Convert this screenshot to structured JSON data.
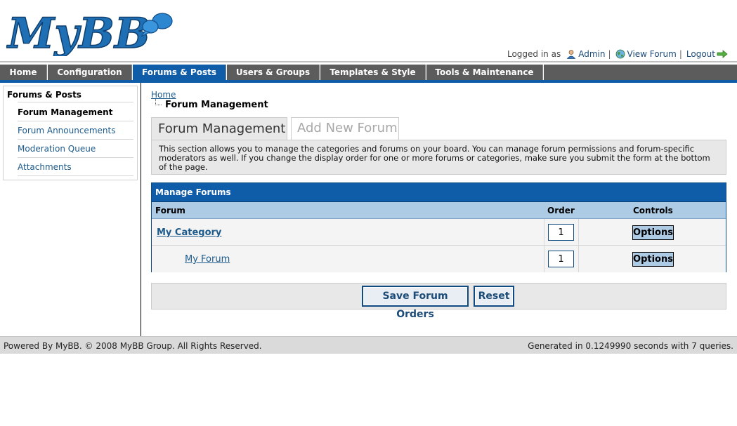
{
  "header": {
    "logo_text": "MyBB",
    "logged_in_as": "Logged in as",
    "user_name": "Admin",
    "view_forum": "View Forum",
    "logout": "Logout",
    "separator": "|"
  },
  "nav": {
    "tabs": [
      {
        "label": "Home"
      },
      {
        "label": "Configuration"
      },
      {
        "label": "Forums & Posts"
      },
      {
        "label": "Users & Groups"
      },
      {
        "label": "Templates & Style"
      },
      {
        "label": "Tools & Maintenance"
      }
    ],
    "active": "Forums & Posts"
  },
  "sidebar": {
    "title": "Forums & Posts",
    "items": [
      {
        "label": "Forum Management"
      },
      {
        "label": "Forum Announcements"
      },
      {
        "label": "Moderation Queue"
      },
      {
        "label": "Attachments"
      }
    ]
  },
  "breadcrumb": {
    "home": "Home",
    "current": "Forum Management"
  },
  "tabs": {
    "active": "Forum Management",
    "inactive": "Add New Forum"
  },
  "description": "This section allows you to manage the categories and forums on your board. You can manage forum permissions and forum-specific moderators as well. If you change the display order for one or more forums or categories, make sure you submit the form at the bottom of the page.",
  "table": {
    "title": "Manage Forums",
    "columns": {
      "forum": "Forum",
      "order": "Order",
      "controls": "Controls"
    },
    "rows": [
      {
        "name": "My Category",
        "order": "1",
        "options": "Options"
      },
      {
        "name": "My Forum",
        "order": "1",
        "options": "Options"
      }
    ]
  },
  "buttons": {
    "save": "Save Forum Orders",
    "reset": "Reset"
  },
  "footer": {
    "left": "Powered By MyBB. © 2008 MyBB Group. All Rights Reserved.",
    "right": "Generated in 0.1249990 seconds with 7 queries."
  },
  "colors": {
    "accent": "#0f5ca8",
    "nav_gray": "#5c5c5c",
    "link": "#1c5a8c",
    "table_subhead": "#aecbe6"
  }
}
